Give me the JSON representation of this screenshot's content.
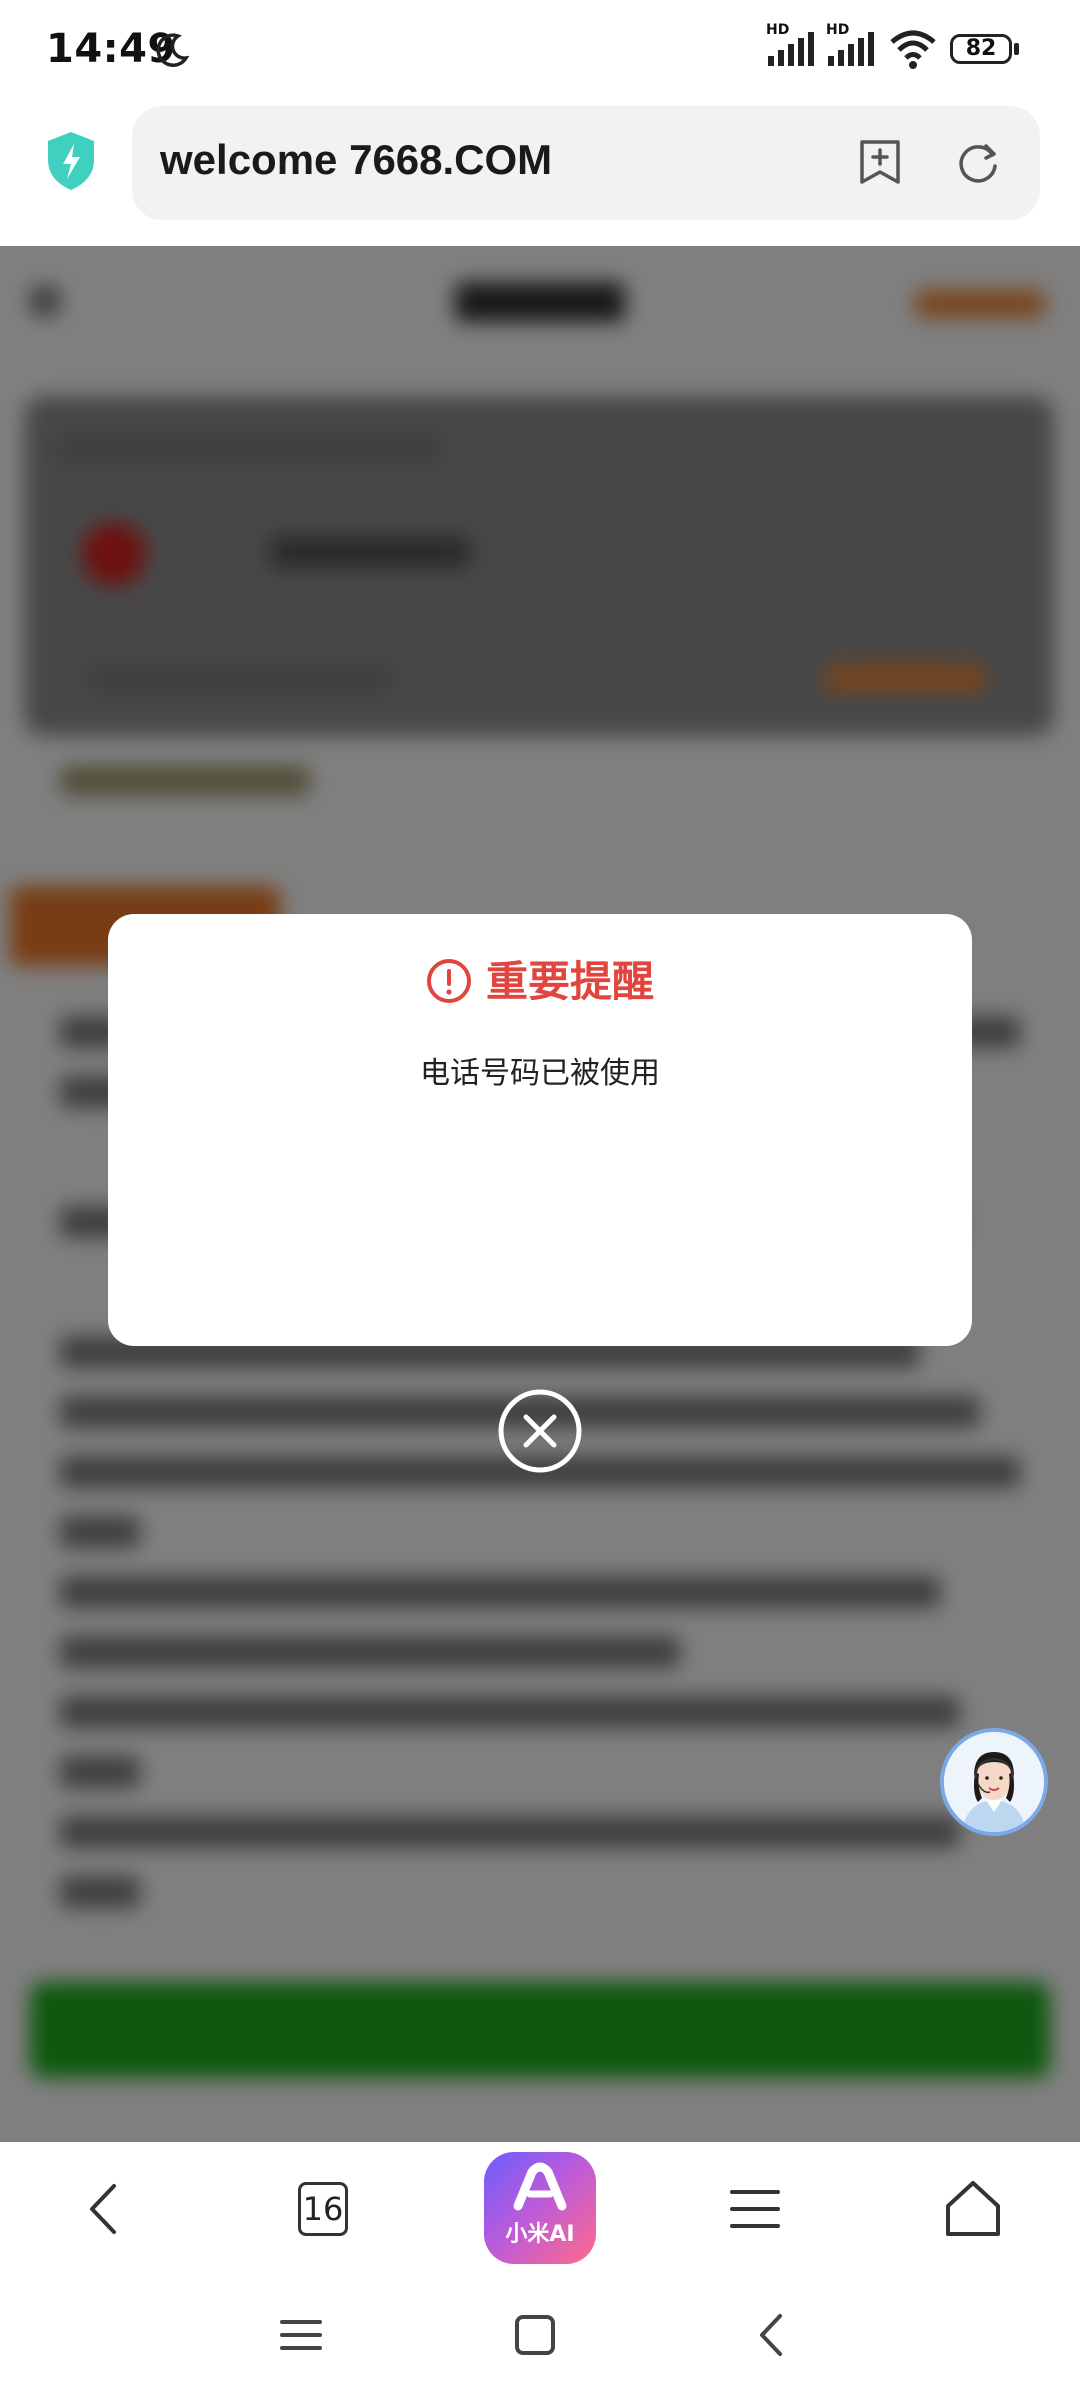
{
  "status": {
    "time": "14:49",
    "hd1": "HD",
    "hd2": "HD",
    "battery": "82"
  },
  "browser": {
    "url": "welcome 7668.COM",
    "tab_count": "16",
    "ai_label": "小米AI"
  },
  "dialog": {
    "title": "重要提醒",
    "message": "电话号码已被使用"
  },
  "colors": {
    "alert_red": "#e0463f",
    "overlay": "rgba(0,0,0,0.5)",
    "shield": "#3fd0c0",
    "blurred_button": "#1db01d",
    "blurred_accent": "#f08a3a"
  }
}
